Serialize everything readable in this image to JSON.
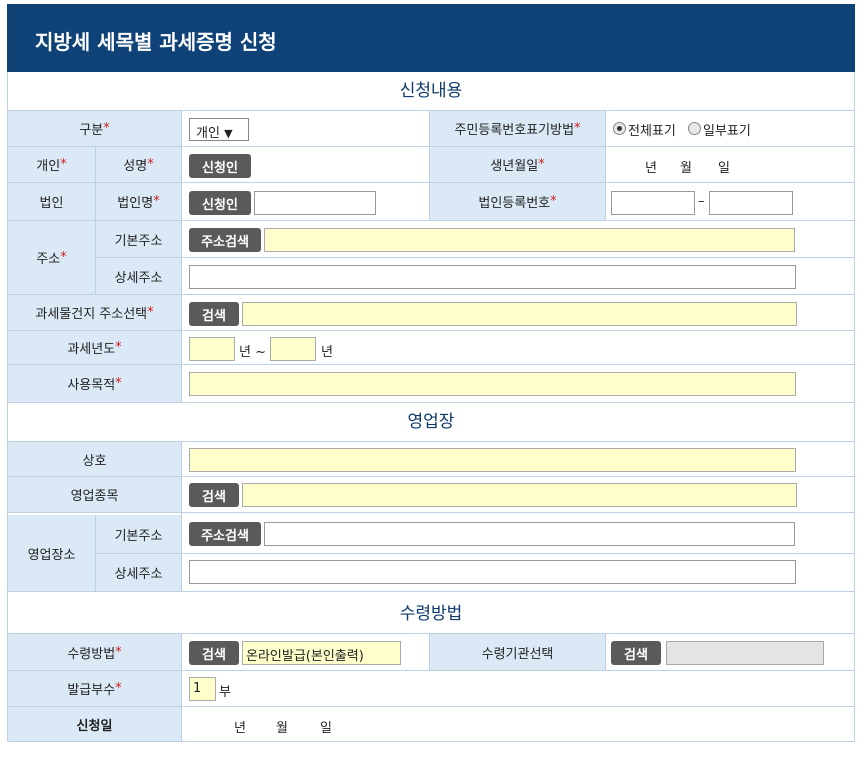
{
  "page_title": "지방세 세목별 과세증명 신청",
  "sections": {
    "application": "신청내용",
    "business": "영업장",
    "receipt": "수령방법"
  },
  "required_mark": "*",
  "labels": {
    "category": "구분",
    "id_display_method": "주민등록번호표기방법",
    "individual": "개인",
    "name": "성명",
    "birth_date": "생년월일",
    "corporation": "법인",
    "corp_name": "법인명",
    "corp_reg_no": "법인등록번호",
    "address": "주소",
    "basic_address": "기본주소",
    "detail_address": "상세주소",
    "taxable_address_select": "과세물건지 주소선택",
    "tax_year": "과세년도",
    "purpose": "사용목적",
    "trade_name": "상호",
    "business_type": "영업종목",
    "business_address": "영업장소",
    "biz_basic_address": "기본주소",
    "biz_detail_address": "상세주소",
    "receipt_method": "수령방법",
    "receipt_agency_select": "수령기관선택",
    "copies": "발급부수",
    "application_date": "신청일"
  },
  "category_select": {
    "value": "개인",
    "arrow": "▼"
  },
  "radio": {
    "full": "전체표기",
    "partial": "일부표기",
    "selected": "full"
  },
  "date_units": {
    "year": "년",
    "month": "월",
    "day": "일"
  },
  "buttons": {
    "applicant": "신청인",
    "corp_applicant": "신청인",
    "address_search": "주소검색",
    "taxable_search": "검색",
    "business_type_search": "검색",
    "biz_address_search": "주소검색",
    "receipt_method_search": "검색",
    "receipt_agency_search": "검색"
  },
  "corp_reg_separator": "–",
  "tax_year": {
    "from_unit": "년 ~",
    "to_unit": "년"
  },
  "receipt_method_value": "온라인발급(본인출력)",
  "copies": {
    "value": "1",
    "unit": "부"
  }
}
